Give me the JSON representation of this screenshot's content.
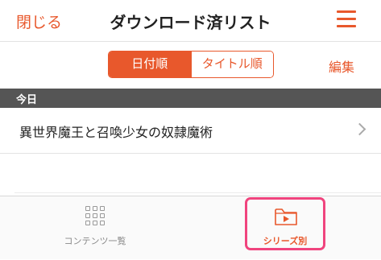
{
  "header": {
    "close_label": "閉じる",
    "title": "ダウンロード済リスト",
    "menu_icon": "hamburger-menu-icon"
  },
  "sort": {
    "options": [
      "日付順",
      "タイトル順"
    ],
    "selected": "日付順",
    "edit_label": "編集"
  },
  "sections": [
    {
      "heading": "今日",
      "items": [
        {
          "title": "異世界魔王と召喚少女の奴隷魔術"
        }
      ]
    }
  ],
  "tabbar": {
    "items": [
      {
        "label": "コンテンツ一覧",
        "icon": "grid-icon",
        "active": false
      },
      {
        "label": "シリーズ別",
        "icon": "folder-play-icon",
        "active": true
      }
    ]
  },
  "colors": {
    "accent": "#e8582c",
    "section_bg": "#555555",
    "highlight": "#f0447e"
  }
}
